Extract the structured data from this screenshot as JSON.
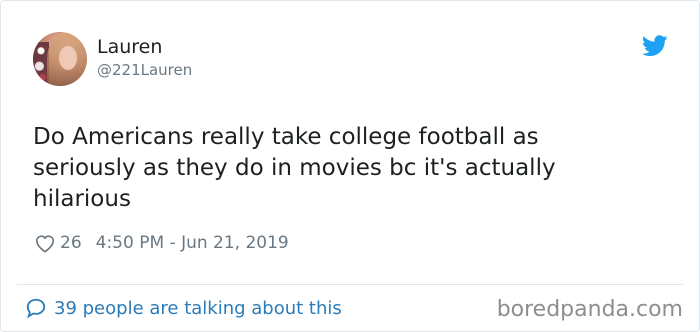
{
  "user": {
    "display_name": "Lauren",
    "handle": "@221Lauren"
  },
  "tweet": {
    "text": "Do Americans really take college football as\nseriously as they do in movies bc it's actually\nhilarious",
    "likes": "26",
    "timestamp": "4:50 PM - Jun 21, 2019"
  },
  "footer": {
    "talking": "39 people are talking about this"
  },
  "watermark": "boredpanda.com",
  "icons": {
    "brand": "twitter-bird-icon",
    "like": "heart-icon",
    "reply": "speech-bubble-icon"
  },
  "colors": {
    "twitter_blue": "#1da1f2",
    "link_blue": "#2b7bb9",
    "text": "#1c2022",
    "muted": "#697882"
  }
}
